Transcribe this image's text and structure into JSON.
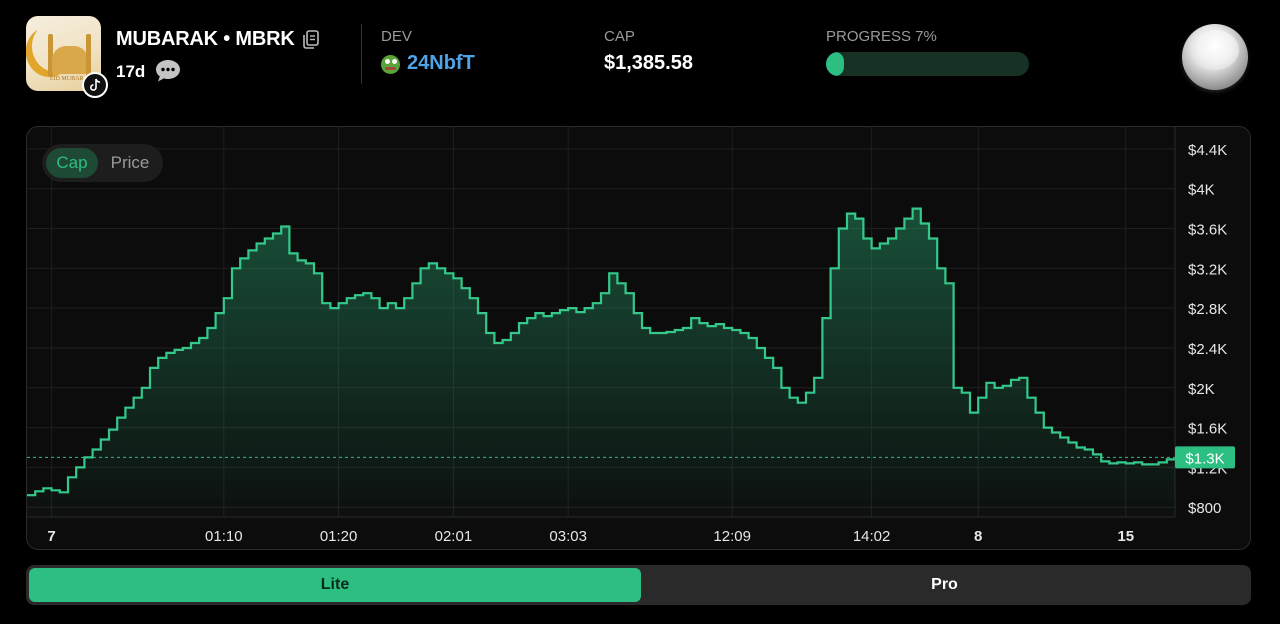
{
  "token": {
    "image_caption": "EID MUBARAK",
    "name": "MUBARAK • MBRK",
    "age": "17d"
  },
  "stats": {
    "dev_label": "DEV",
    "dev_value": "24NbfT",
    "cap_label": "CAP",
    "cap_value": "$1,385.58",
    "progress_label": "PROGRESS 7%",
    "progress_fraction": 0.07
  },
  "icons": {
    "copy": "copy-icon",
    "comment": "comment-icon",
    "platform": "tiktok-icon",
    "dev_avatar": "pepe-avatar-icon"
  },
  "toggle": {
    "cap": "Cap",
    "price": "Price",
    "selected": "Cap"
  },
  "colors": {
    "accent": "#2dbe82",
    "dev_link": "#4fa3e6",
    "background": "#000000"
  },
  "chart_data": {
    "type": "area",
    "step": true,
    "ylim": [
      400,
      4600
    ],
    "y_ticks": [
      "$4.4K",
      "$4K",
      "$3.6K",
      "$3.2K",
      "$2.8K",
      "$2.4K",
      "$2K",
      "$1.6K",
      "$1.2K",
      "$800"
    ],
    "y_tick_values": [
      4400,
      4000,
      3600,
      3200,
      2800,
      2400,
      2000,
      1600,
      1200,
      800
    ],
    "x_ticks": [
      {
        "label": "7",
        "bold": true,
        "index": 3
      },
      {
        "label": "01:10",
        "bold": false,
        "index": 24
      },
      {
        "label": "01:20",
        "bold": false,
        "index": 38
      },
      {
        "label": "02:01",
        "bold": false,
        "index": 52
      },
      {
        "label": "03:03",
        "bold": false,
        "index": 66
      },
      {
        "label": "12:09",
        "bold": false,
        "index": 86
      },
      {
        "label": "14:02",
        "bold": false,
        "index": 103
      },
      {
        "label": "8",
        "bold": true,
        "index": 116
      },
      {
        "label": "15",
        "bold": true,
        "index": 134
      }
    ],
    "current_value": 1300,
    "current_label": "$1.3K",
    "grid": true,
    "values": [
      920,
      960,
      990,
      970,
      950,
      1100,
      1200,
      1300,
      1380,
      1480,
      1580,
      1700,
      1800,
      1900,
      2000,
      2200,
      2300,
      2350,
      2380,
      2400,
      2450,
      2500,
      2600,
      2750,
      2900,
      3200,
      3300,
      3380,
      3450,
      3500,
      3550,
      3620,
      3350,
      3280,
      3250,
      3150,
      2850,
      2800,
      2850,
      2900,
      2930,
      2950,
      2900,
      2800,
      2850,
      2800,
      2900,
      3050,
      3200,
      3250,
      3200,
      3150,
      3100,
      3000,
      2900,
      2750,
      2550,
      2450,
      2480,
      2550,
      2650,
      2700,
      2750,
      2720,
      2750,
      2780,
      2800,
      2760,
      2800,
      2850,
      2950,
      3150,
      3050,
      2950,
      2750,
      2600,
      2550,
      2550,
      2560,
      2580,
      2600,
      2700,
      2650,
      2620,
      2640,
      2600,
      2580,
      2550,
      2500,
      2400,
      2300,
      2200,
      2000,
      1900,
      1850,
      1950,
      2100,
      2700,
      3200,
      3600,
      3750,
      3700,
      3500,
      3400,
      3450,
      3500,
      3600,
      3700,
      3800,
      3650,
      3500,
      3200,
      3050,
      2000,
      1950,
      1750,
      1900,
      2050,
      2000,
      2020,
      2080,
      2100,
      1900,
      1750,
      1600,
      1550,
      1500,
      1450,
      1400,
      1380,
      1330,
      1260,
      1240,
      1250,
      1240,
      1250,
      1230,
      1230,
      1250,
      1280
    ]
  },
  "mode_switch": {
    "lite": "Lite",
    "pro": "Pro",
    "selected": "Lite"
  }
}
